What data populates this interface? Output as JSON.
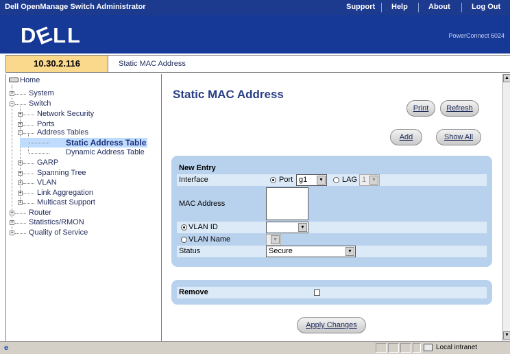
{
  "topbar": {
    "title": "Dell OpenManage Switch Administrator",
    "links": [
      "Support",
      "Help",
      "About",
      "Log Out"
    ]
  },
  "brand": {
    "logo": "DELL",
    "product": "PowerConnect 6024"
  },
  "address": {
    "ip": "10.30.2.116",
    "breadcrumb": "Static MAC Address"
  },
  "tree": {
    "home": "Home",
    "system": "System",
    "switch": "Switch",
    "network_security": "Network Security",
    "ports": "Ports",
    "address_tables": "Address Tables",
    "static_address_table": "Static Address Table",
    "dynamic_address_table": "Dynamic Address Table",
    "garp": "GARP",
    "spanning_tree": "Spanning Tree",
    "vlan": "VLAN",
    "link_aggregation": "Link Aggregation",
    "multicast_support": "Multicast Support",
    "router": "Router",
    "statistics": "Statistics/RMON",
    "qos": "Quality of Service"
  },
  "main": {
    "title": "Static MAC Address",
    "buttons": {
      "print": "Print",
      "refresh": "Refresh",
      "add": "Add",
      "show_all": "Show All",
      "apply": "Apply Changes"
    },
    "new_entry": {
      "heading": "New Entry",
      "interface_label": "Interface",
      "port_label": "Port",
      "port_value": "g1",
      "lag_label": "LAG",
      "lag_value": "1",
      "mac_label": "MAC Address",
      "mac_value": "",
      "vlan_id_label": "VLAN ID",
      "vlan_id_value": "",
      "vlan_name_label": "VLAN Name",
      "vlan_name_value": "",
      "status_label": "Status",
      "status_value": "Secure"
    },
    "remove": {
      "label": "Remove",
      "checked": false
    }
  },
  "statusbar": {
    "zone": "Local intranet"
  },
  "colors": {
    "topbar": "#1c3a8e",
    "brand": "#163897",
    "ip_box": "#fbd98c",
    "form_bg": "#b8d1ec",
    "form_row": "#dceaf8",
    "selected": "#bfdcff"
  }
}
